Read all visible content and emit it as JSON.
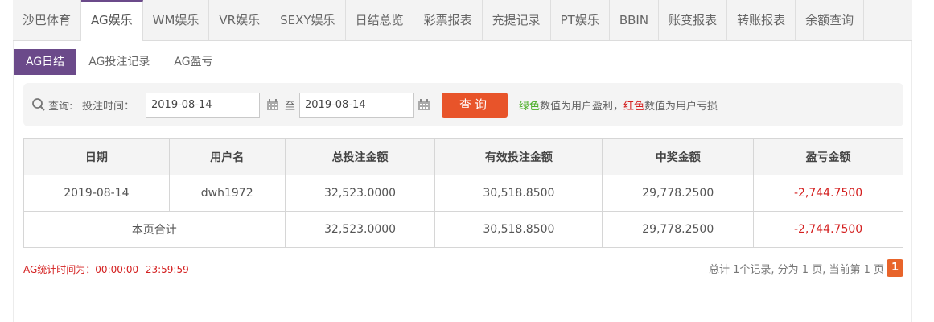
{
  "top_tabs": [
    {
      "label": "沙巴体育"
    },
    {
      "label": "AG娱乐",
      "active": true
    },
    {
      "label": "WM娱乐"
    },
    {
      "label": "VR娱乐"
    },
    {
      "label": "SEXY娱乐"
    },
    {
      "label": "日结总览"
    },
    {
      "label": "彩票报表"
    },
    {
      "label": "充提记录"
    },
    {
      "label": "PT娱乐"
    },
    {
      "label": "BBIN"
    },
    {
      "label": "账变报表"
    },
    {
      "label": "转账报表"
    },
    {
      "label": "余额查询"
    }
  ],
  "sub_tabs": [
    {
      "label": "AG日结",
      "active": true
    },
    {
      "label": "AG投注记录"
    },
    {
      "label": "AG盈亏"
    }
  ],
  "query": {
    "search_label": "查询:",
    "time_label": "投注时间：",
    "start_date": "2019-08-14",
    "to_label": "至",
    "end_date": "2019-08-14",
    "button": "查询",
    "legend_green": "绿色",
    "legend_green_text": "数值为用户盈利，",
    "legend_red": "红色",
    "legend_red_text": "数值为用户亏损"
  },
  "table": {
    "headers": [
      "日期",
      "用户名",
      "总投注金额",
      "有效投注金额",
      "中奖金额",
      "盈亏金额"
    ],
    "rows": [
      [
        "2019-08-14",
        "dwh1972",
        "32,523.0000",
        "30,518.8500",
        "29,778.2500",
        "-2,744.7500"
      ]
    ],
    "total": {
      "label": "本页合计",
      "values": [
        "32,523.0000",
        "30,518.8500",
        "29,778.2500",
        "-2,744.7500"
      ]
    }
  },
  "footer": {
    "note": "AG统计时间为：00:00:00--23:59:59",
    "pager_text": "总计 1个记录, 分为 1 页, 当前第 1 页",
    "current_page": "1"
  },
  "colors": {
    "accent": "#6b4a8a",
    "button": "#e8542a",
    "positive": "#4caf28",
    "negative": "#d42020"
  }
}
